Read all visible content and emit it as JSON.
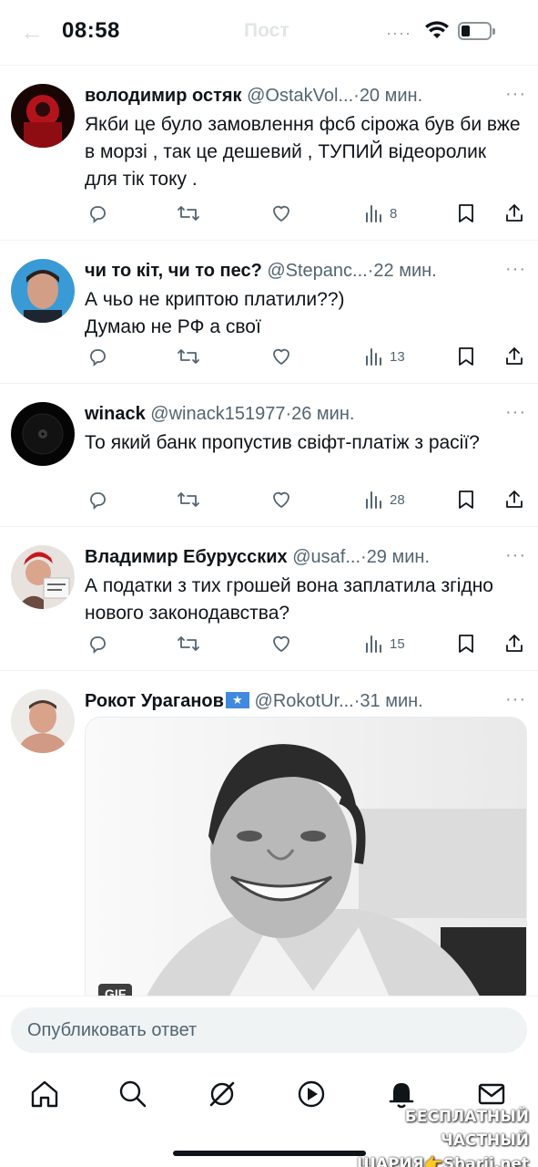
{
  "status_bar": {
    "time": "08:58",
    "header_title": "Пост"
  },
  "tweets": [
    {
      "name": "володимир остяк",
      "handle": "@OstakVol...",
      "separator": "·",
      "time_ago": "20 мин.",
      "text": "Якби це було замовлення фсб сірожа був би вже в морзі , так це дешевий , ТУПИЙ відеоролик для тік току .",
      "views": "8"
    },
    {
      "name": "чи то кіт, чи то пес?",
      "handle": "@Stepanc...",
      "separator": "·",
      "time_ago": "22 мин.",
      "text": "А чьо не криптою платили??)\nДумаю не РФ а свої",
      "views": "13"
    },
    {
      "name": "winack",
      "handle": "@winack151977",
      "separator": "·",
      "time_ago": "26 мин.",
      "text": "То який банк пропустив свіфт-платіж з расії?",
      "views": "28"
    },
    {
      "name": "Владимир Ебурусских",
      "handle": "@usaf...",
      "separator": "·",
      "time_ago": "29 мин.",
      "text": "А податки з тих грошей вона заплатила згідно нового законодавства?",
      "views": "15"
    },
    {
      "name": "Рокот Ураганов",
      "flag_glyph": "★",
      "handle": "@RokotUr...",
      "separator": "·",
      "time_ago": "31 мин.",
      "media_badge": "GIF"
    }
  ],
  "more_glyph": "···",
  "reply": {
    "placeholder": "Опубликовать ответ"
  },
  "bottom_nav": [
    "home-icon",
    "search-icon",
    "grok-icon",
    "video-icon",
    "notifications-icon",
    "messages-icon"
  ],
  "watermark": {
    "line1": "БЕСПЛАТНЫЙ ЧАСТНЫЙ",
    "line2": "ШАРИЯ👉Sharij.net"
  },
  "colors": {
    "text": "#0f1419",
    "secondary": "#536471",
    "divider": "#eff3f4",
    "input_bg": "#eff3f4"
  }
}
